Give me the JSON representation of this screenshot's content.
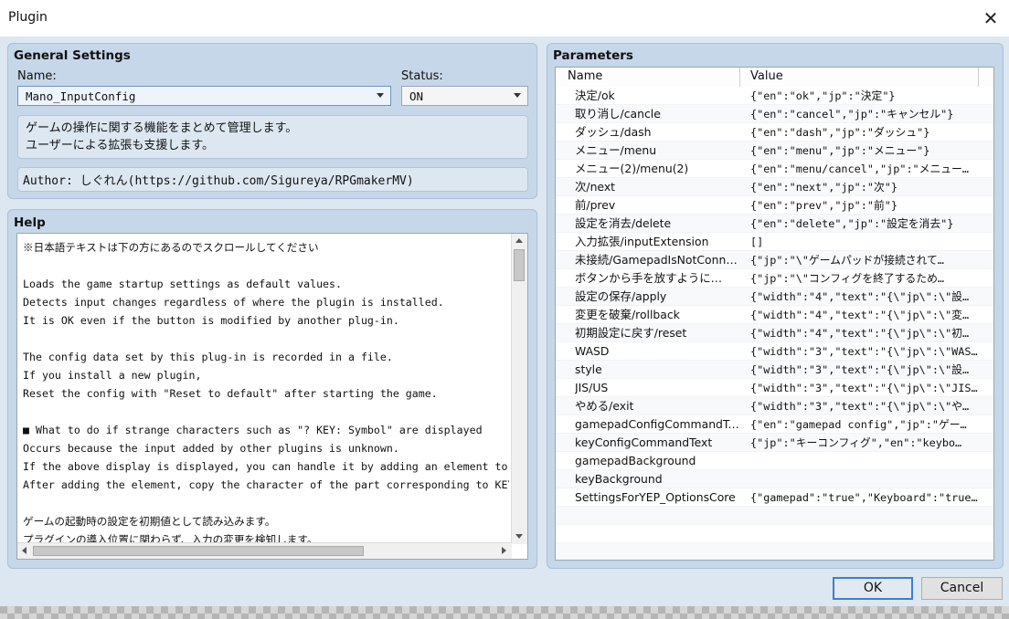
{
  "window": {
    "title": "Plugin"
  },
  "general": {
    "title": "General Settings",
    "name_label": "Name:",
    "name_value": "Mano_InputConfig",
    "status_label": "Status:",
    "status_value": "ON",
    "description_line1": "ゲームの操作に関する機能をまとめて管理します。",
    "description_line2": "ユーザーによる拡張も支援します。",
    "author": "Author: しぐれん(https://github.com/Sigureya/RPGmakerMV)"
  },
  "help": {
    "title": "Help",
    "lines": [
      "※日本語テキストは下の方にあるのでスクロールしてください",
      "",
      "Loads the game startup settings as default values.",
      "Detects input changes regardless of where the plugin is installed.",
      "It is OK even if the button is modified by another plug-in.",
      "",
      "The config data set by this plug-in is recorded in a file.",
      "If you install a new plugin,",
      "Reset the config with \"Reset to default\" after starting the game.",
      "",
      "■ What to do if strange characters such as \"? KEY: Symbol\" are displayed",
      "Occurs because the input added by other plugins is unknown.",
      "If the above display is displayed, you can handle it by adding an element to e",
      "After adding the element, copy the character of the part corresponding to KEY a",
      "",
      "ゲームの起動時の設定を初期値として読み込みます。",
      "プラグインの導入位置に関わらず、入力の変更を検知します。"
    ]
  },
  "parameters": {
    "title": "Parameters",
    "col_name": "Name",
    "col_value": "Value",
    "rows": [
      {
        "name": "決定/ok",
        "value": "{\"en\":\"ok\",\"jp\":\"決定\"}"
      },
      {
        "name": "取り消し/cancle",
        "value": "{\"en\":\"cancel\",\"jp\":\"キャンセル\"}"
      },
      {
        "name": "ダッシュ/dash",
        "value": "{\"en\":\"dash\",\"jp\":\"ダッシュ\"}"
      },
      {
        "name": "メニュー/menu",
        "value": "{\"en\":\"menu\",\"jp\":\"メニュー\"}"
      },
      {
        "name": "メニュー(2)/menu(2)",
        "value": "{\"en\":\"menu/cancel\",\"jp\":\"メニュー…"
      },
      {
        "name": "次/next",
        "value": "{\"en\":\"next\",\"jp\":\"次\"}"
      },
      {
        "name": "前/prev",
        "value": "{\"en\":\"prev\",\"jp\":\"前\"}"
      },
      {
        "name": "設定を消去/delete",
        "value": "{\"en\":\"delete\",\"jp\":\"設定を消去\"}"
      },
      {
        "name": "入力拡張/inputExtension",
        "value": "[]"
      },
      {
        "name": "未接続/GamepadIsNotConne…",
        "value": "{\"jp\":\"\\\"ゲームパッドが接続されて…"
      },
      {
        "name": "ボタンから手を放すように…",
        "value": "{\"jp\":\"\\\"コンフィグを終了するため…"
      },
      {
        "name": "設定の保存/apply",
        "value": "{\"width\":\"4\",\"text\":\"{\\\"jp\\\":\\\"設…"
      },
      {
        "name": "変更を破棄/rollback",
        "value": "{\"width\":\"4\",\"text\":\"{\\\"jp\\\":\\\"変…"
      },
      {
        "name": "初期設定に戻す/reset",
        "value": "{\"width\":\"4\",\"text\":\"{\\\"jp\\\":\\\"初…"
      },
      {
        "name": "WASD",
        "value": "{\"width\":\"3\",\"text\":\"{\\\"jp\\\":\\\"WAS…"
      },
      {
        "name": "style",
        "value": "{\"width\":\"3\",\"text\":\"{\\\"jp\\\":\\\"設…"
      },
      {
        "name": "JIS/US",
        "value": "{\"width\":\"3\",\"text\":\"{\\\"jp\\\":\\\"JIS…"
      },
      {
        "name": "やめる/exit",
        "value": "{\"width\":\"3\",\"text\":\"{\\\"jp\\\":\\\"や…"
      },
      {
        "name": "gamepadConfigCommandText",
        "value": "{\"en\":\"gamepad config\",\"jp\":\"ゲー…"
      },
      {
        "name": "keyConfigCommandText",
        "value": "{\"jp\":\"キーコンフィグ\",\"en\":\"keybo…"
      },
      {
        "name": "gamepadBackground",
        "value": ""
      },
      {
        "name": "keyBackground",
        "value": ""
      },
      {
        "name": "SettingsForYEP_OptionsCore",
        "value": "{\"gamepad\":\"true\",\"Keyboard\":\"true\"}"
      },
      {
        "name": "",
        "value": ""
      },
      {
        "name": "",
        "value": ""
      },
      {
        "name": "",
        "value": ""
      }
    ]
  },
  "buttons": {
    "ok": "OK",
    "cancel": "Cancel"
  }
}
